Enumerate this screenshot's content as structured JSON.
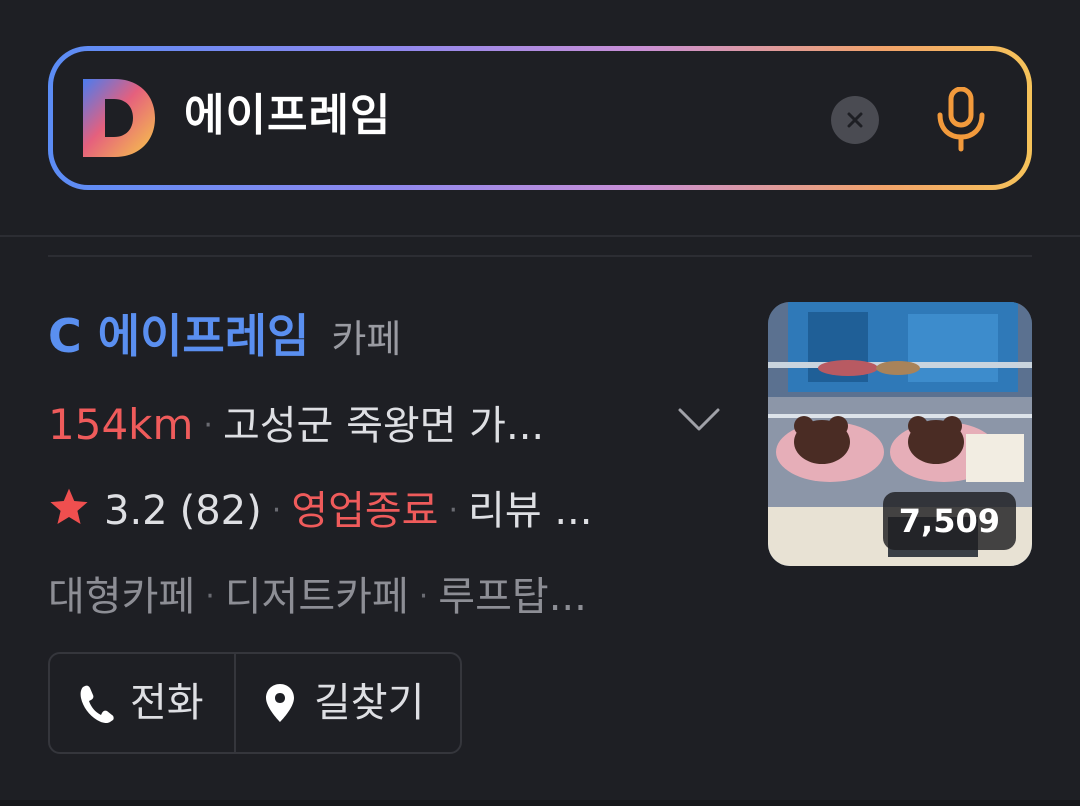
{
  "search": {
    "query": "에이프레임",
    "clear_icon": "close-icon",
    "voice_icon": "microphone-icon",
    "logo": "daum-d-logo"
  },
  "result": {
    "name": "C 에이프레임",
    "category": "카페",
    "distance": "154km",
    "address": "고성군 죽왕면 가...",
    "rating_value": "3.2",
    "review_count": "(82)",
    "status": "영업종료",
    "review_label": "리뷰 ...",
    "separator": "·",
    "tags": [
      "대형카페",
      "디저트카페",
      "루프탑..."
    ],
    "photo_count": "7,509",
    "actions": {
      "call_label": "전화",
      "route_label": "길찾기"
    }
  },
  "colors": {
    "accent_blue": "#5a8ff0",
    "distance_red": "#ef5b5b",
    "status_red": "#ef5b5b",
    "background": "#1e1f24"
  }
}
